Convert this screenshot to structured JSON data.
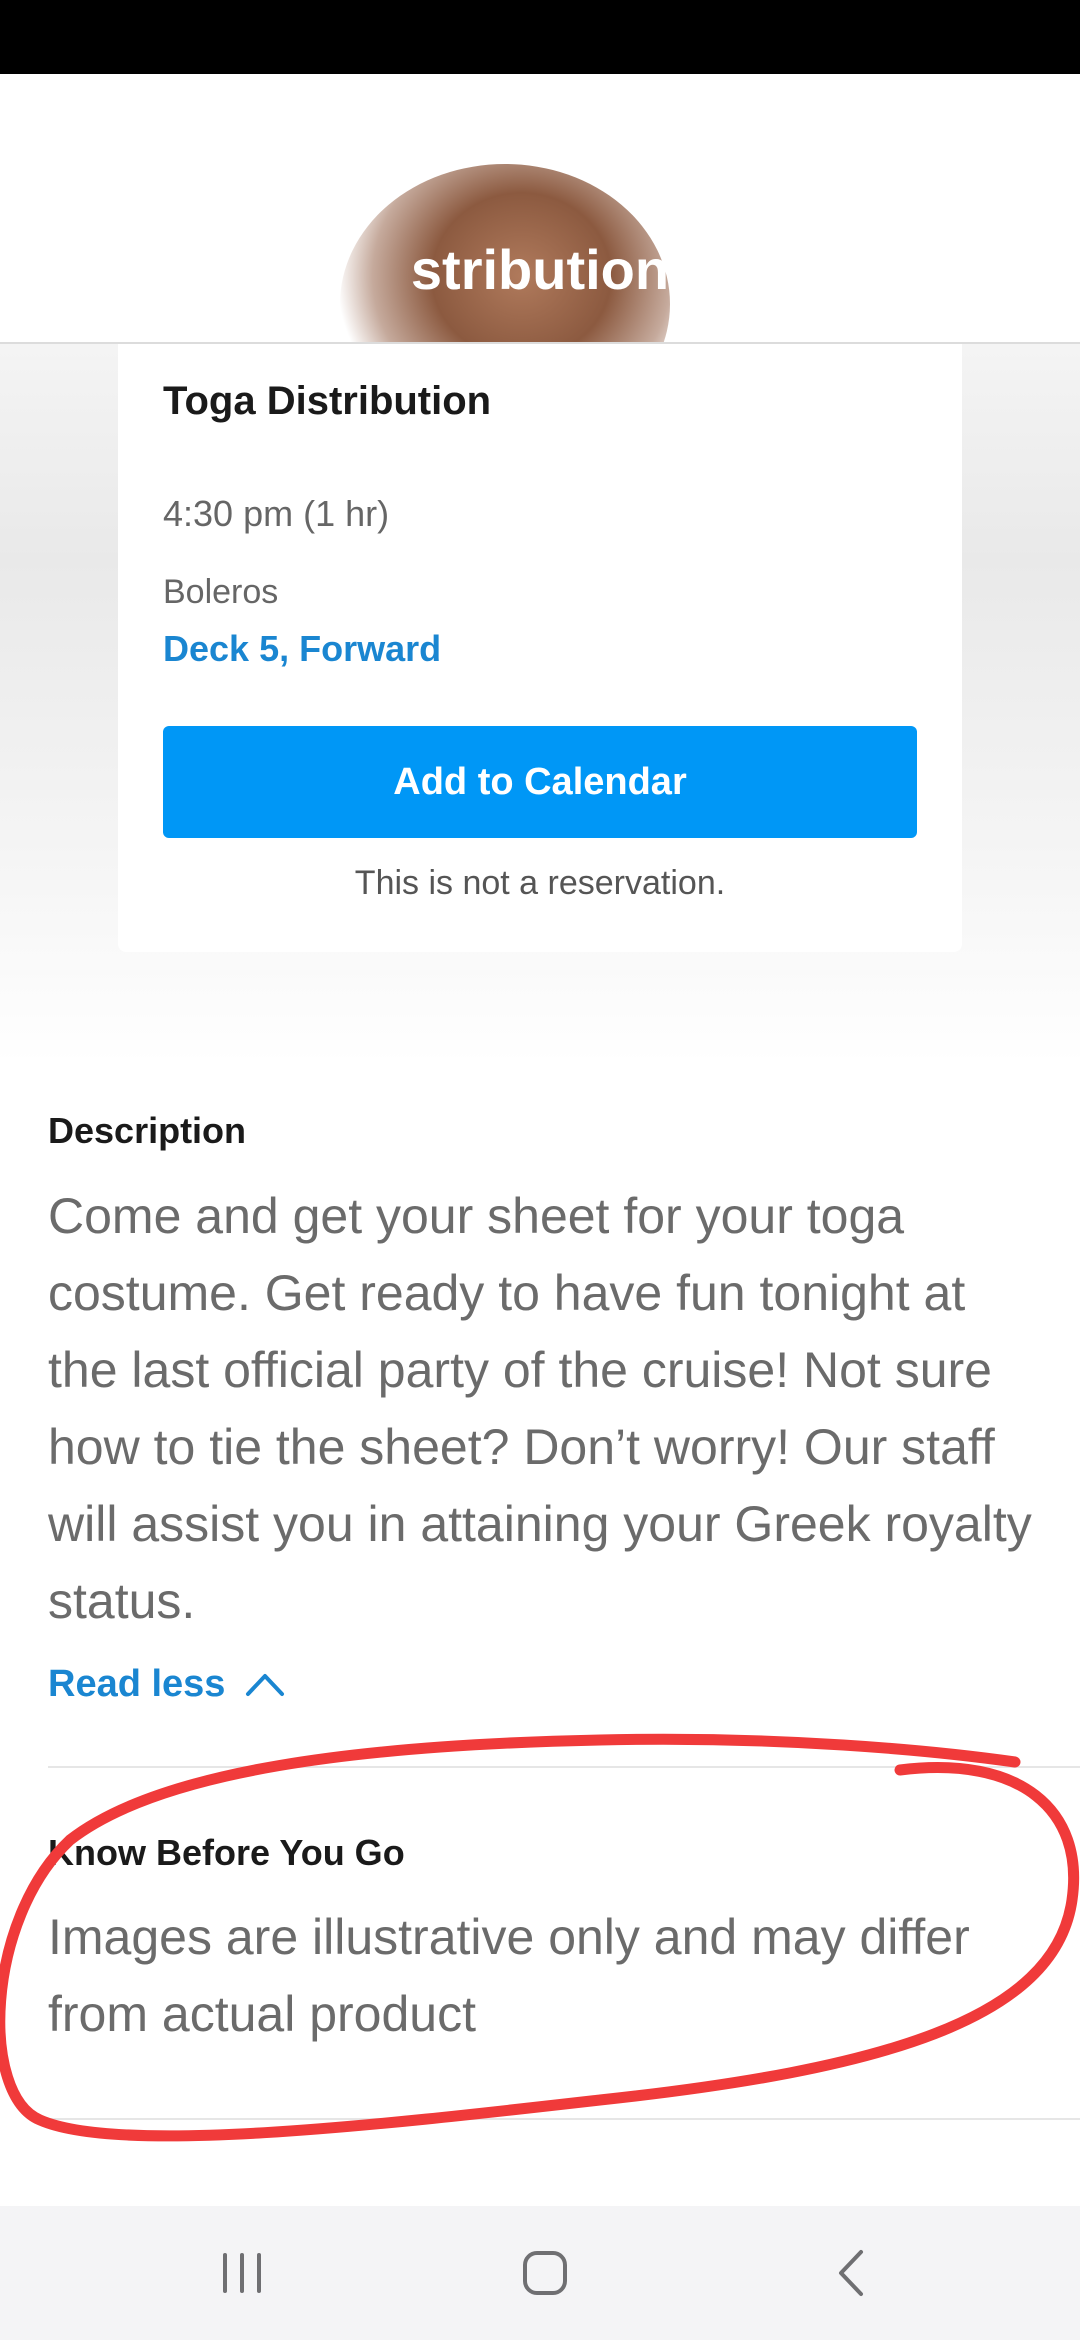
{
  "hero": {
    "title_fragment": "stribution"
  },
  "event_card": {
    "title": "Toga Distribution",
    "time": "4:30 pm (1 hr)",
    "venue": "Boleros",
    "location": "Deck 5, Forward",
    "add_to_calendar_label": "Add to Calendar",
    "reservation_note": "This is not a reservation."
  },
  "description": {
    "heading": "Description",
    "body": "Come and get your sheet for your toga costume. Get ready to have fun tonight at the last official party of the cruise! Not sure how to tie the sheet? Don’t worry! Our staff will assist you in attaining your Greek royalty status.",
    "read_less_label": "Read less"
  },
  "know_before_you_go": {
    "heading": "Know Before You Go",
    "body": "Images are illustrative only and may differ from actual product"
  },
  "icons": {
    "read_less": "chevron-up-icon",
    "nav_recents": "recent-apps-icon",
    "nav_home": "home-icon",
    "nav_back": "back-chevron-icon"
  },
  "colors": {
    "accent_blue": "#0097f6",
    "link_blue": "#1a86d1",
    "annotation_red": "#f03a3a",
    "body_gray": "#6b6b6b"
  }
}
